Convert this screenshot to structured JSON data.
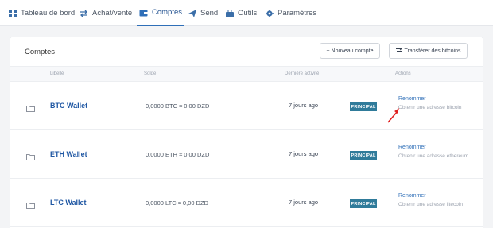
{
  "nav": {
    "items": [
      {
        "label": "Tableau de bord",
        "icon": "grid-icon"
      },
      {
        "label": "Achat/vente",
        "icon": "swap-icon"
      },
      {
        "label": "Comptes",
        "icon": "wallet-icon",
        "active": true
      },
      {
        "label": "Send",
        "icon": "send-icon"
      },
      {
        "label": "Outils",
        "icon": "briefcase-icon"
      },
      {
        "label": "Paramètres",
        "icon": "gear-icon"
      }
    ]
  },
  "accounts": {
    "title": "Comptes",
    "new_account_label": "+ Nouveau compte",
    "transfer_label": "Transférer des bitcoins",
    "columns": [
      "Libellé",
      "Solde",
      "Dernière activité",
      "Actions"
    ],
    "rows": [
      {
        "name": "BTC Wallet",
        "balance": "0,0000 BTC ≈ 0,00 DZD",
        "activity": "7 jours ago",
        "badge": "PRINCIPAL",
        "rename": "Renommer",
        "address": "Obtenir une adresse bitcoin"
      },
      {
        "name": "ETH Wallet",
        "balance": "0,0000 ETH ≈ 0,00 DZD",
        "activity": "7 jours ago",
        "badge": "PRINCIPAL",
        "rename": "Renommer",
        "address": "Obtenir une adresse ethereum"
      },
      {
        "name": "LTC Wallet",
        "balance": "0,0000 LTC ≈ 0,00 DZD",
        "activity": "7 jours ago",
        "badge": "PRINCIPAL",
        "rename": "Renommer",
        "address": "Obtenir une adresse litecoin"
      }
    ]
  },
  "colors": {
    "accent": "#1f57a3",
    "badge": "#2f7b9a",
    "cursor": "#e02020"
  }
}
